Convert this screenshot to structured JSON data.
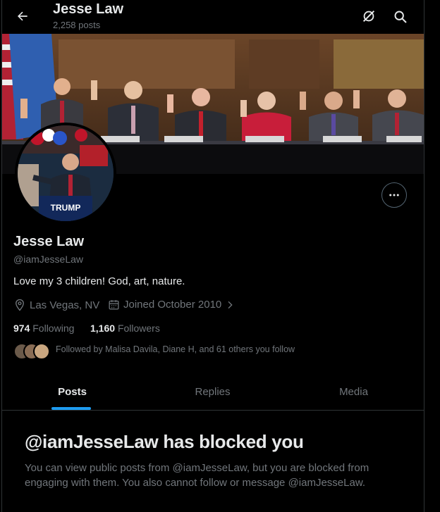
{
  "header": {
    "title": "Jesse Law",
    "posts_count": "2,258 posts",
    "back_icon": "arrow-left-icon",
    "icons": [
      "grok-icon",
      "search-icon"
    ]
  },
  "profile": {
    "name": "Jesse Law",
    "handle": "@iamJesseLaw",
    "bio": "Love my 3 children! God, art, nature.",
    "location": "Las Vegas, NV",
    "joined": "Joined October 2010",
    "following_count": "974",
    "following_label": "Following",
    "followers_count": "1,160",
    "followers_label": "Followers",
    "followed_by": "Followed by Malisa Davila, Diane H, and 61 others you follow",
    "banner_sign_text": "TRUMP"
  },
  "tabs": [
    {
      "label": "Posts",
      "active": true
    },
    {
      "label": "Replies",
      "active": false
    },
    {
      "label": "Media",
      "active": false
    }
  ],
  "blocked": {
    "title": "@iamJesseLaw has blocked you",
    "message": "You can view public posts from @iamJesseLaw, but you are blocked from engaging with them. You also cannot follow or message @iamJesseLaw."
  },
  "colors": {
    "accent": "#1d9bf0",
    "background": "#000000",
    "text_primary": "#e7e9ea",
    "text_secondary": "#71767b",
    "border": "#2f3336"
  }
}
